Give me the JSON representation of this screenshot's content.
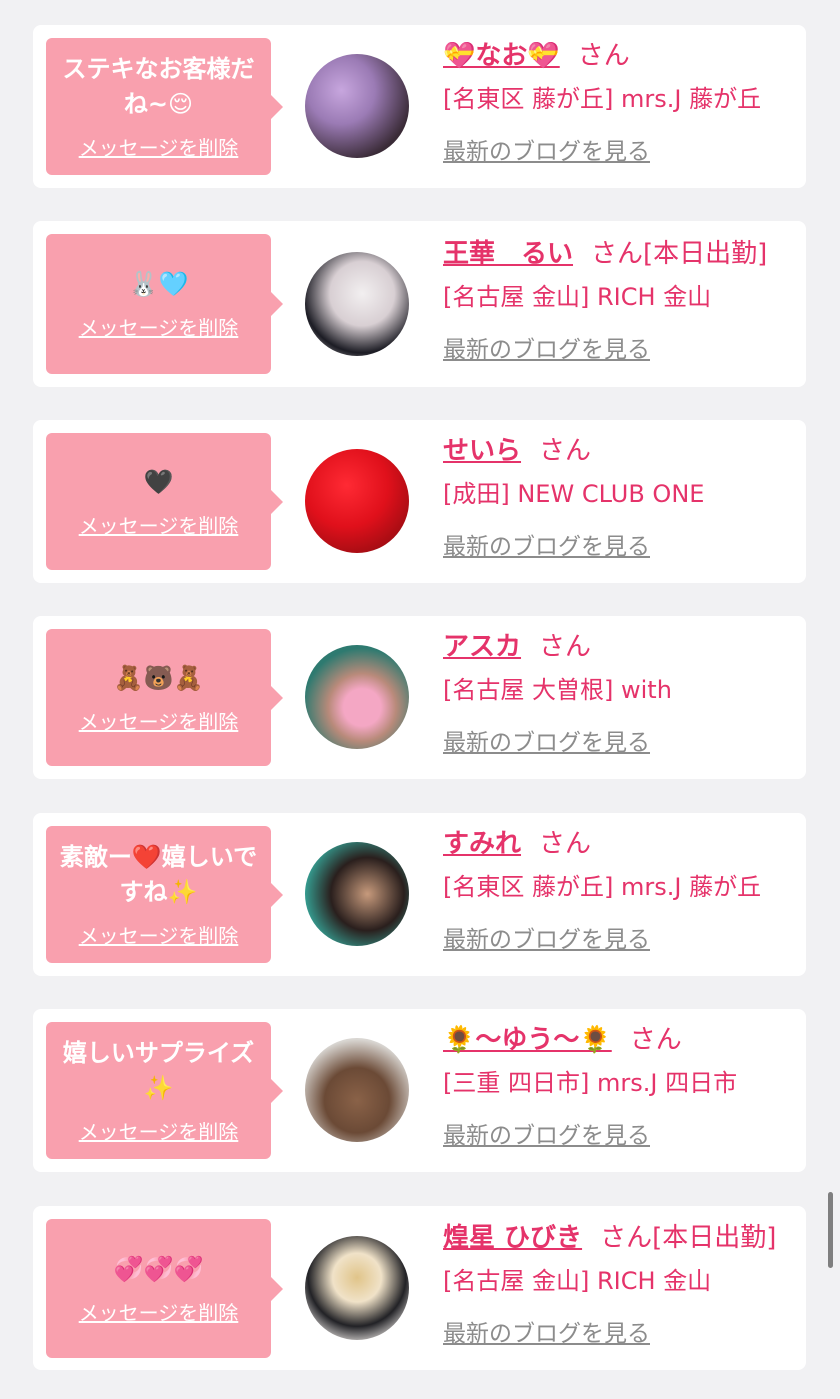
{
  "items": [
    {
      "message": "ステキなお客様だね~😌",
      "delete_label": "メッセージを削除",
      "name": "💝なお💝",
      "suffix": "さん",
      "shop": "[名東区 藤が丘] mrs.J 藤が丘",
      "blog_label": "最新のブログを見る",
      "avatar_colors": [
        "#c7a6de",
        "#3a2b37"
      ]
    },
    {
      "message": "🐰🩵",
      "delete_label": "メッセージを削除",
      "name": "王華　るい",
      "suffix": "さん[本日出勤]",
      "shop": "[名古屋 金山] RICH 金山",
      "blog_label": "最新のブログを見る",
      "avatar_colors": [
        "#f2eff0",
        "#1c1c24"
      ]
    },
    {
      "message": "🖤",
      "delete_label": "メッセージを削除",
      "name": "せいら",
      "suffix": "さん",
      "shop": "[成田] NEW CLUB ONE",
      "blog_label": "最新のブログを見る",
      "avatar_colors": [
        "#e0101b",
        "#7a0a0d"
      ]
    },
    {
      "message": "🧸🐻🧸",
      "delete_label": "メッセージを削除",
      "name": "アスカ",
      "suffix": "さん",
      "shop": "[名古屋 大曽根] with",
      "blog_label": "最新のブログを見る",
      "avatar_colors": [
        "#2e7a70",
        "#f4a7c4"
      ]
    },
    {
      "message": "素敵ー❤️嬉しいですね✨",
      "delete_label": "メッセージを削除",
      "name": "すみれ",
      "suffix": "さん",
      "shop": "[名東区 藤が丘] mrs.J 藤が丘",
      "blog_label": "最新のブログを見る",
      "avatar_colors": [
        "#36a89b",
        "#2a1f1d"
      ]
    },
    {
      "message": "嬉しいサプライズ✨",
      "delete_label": "メッセージを削除",
      "name": "🌻〜ゆう〜🌻",
      "suffix": "さん",
      "shop": "[三重 四日市] mrs.J 四日市",
      "blog_label": "最新のブログを見る",
      "avatar_colors": [
        "#d9d6d2",
        "#6b4a36"
      ]
    },
    {
      "message": "💞💞💞",
      "delete_label": "メッセージを削除",
      "name": "煌星 ひびき",
      "suffix": "さん[本日出勤]",
      "shop": "[名古屋 金山] RICH 金山",
      "blog_label": "最新のブログを見る",
      "avatar_colors": [
        "#eae6e3",
        "#e0c489"
      ]
    }
  ]
}
